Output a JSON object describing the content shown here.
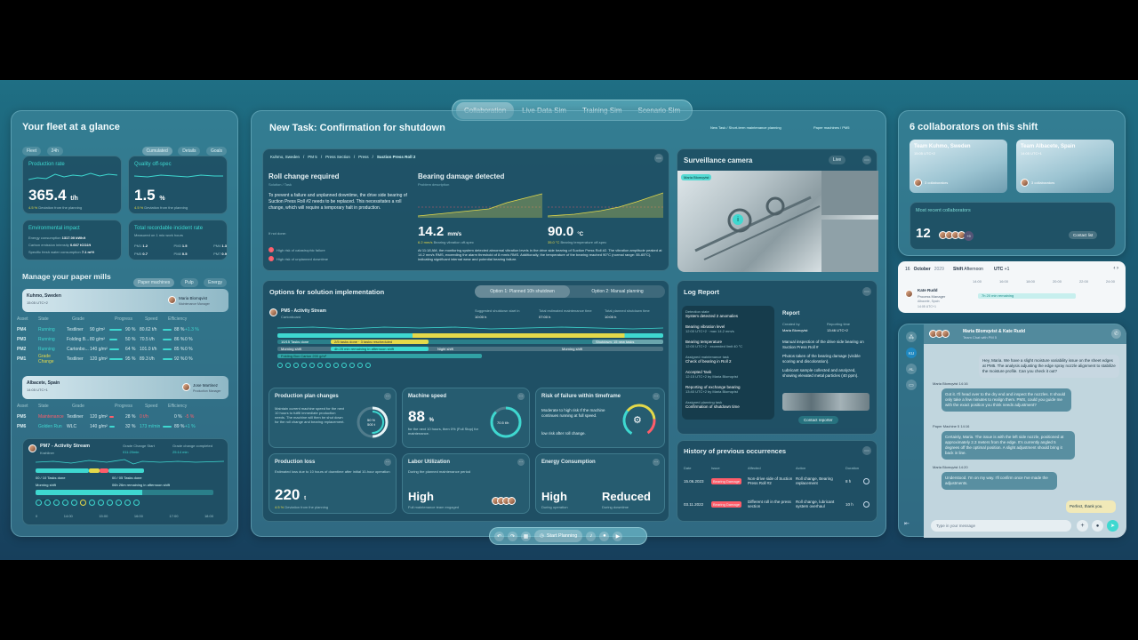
{
  "tabs": [
    "Collaboration",
    "Live Data Sim",
    "Training Sim",
    "Scenario Sim"
  ],
  "fleet": {
    "title": "Your fleet at a glance",
    "filters": [
      "Fleet",
      "24h"
    ],
    "views": [
      "Cumulated",
      "Details",
      "Goals"
    ],
    "production_rate": {
      "label": "Production rate",
      "value": "365.4",
      "unit": "t/h",
      "delta": "4.5 %",
      "note": "Deviation from the planning"
    },
    "quality": {
      "label": "Quality off-spec",
      "value": "1.5",
      "unit": "%",
      "delta": "4.5 %",
      "note": "Deviation from the planning"
    },
    "env": {
      "label": "Environmental impact",
      "lines": [
        [
          "Energy consumption",
          "1317.00 kWh/t"
        ],
        [
          "Carbon emission intensity",
          "0.667 tCO2/t"
        ],
        [
          "Specific fresh water consumption",
          "7.1 m³/t"
        ]
      ]
    },
    "trir": {
      "label": "Total recordable incident rate",
      "sub": "Measured on 1 mio work hours",
      "cells": [
        [
          "PM1",
          "1.2"
        ],
        [
          "PM3",
          "1.5"
        ],
        [
          "PM4",
          "1.3"
        ],
        [
          "PM5",
          "0.7"
        ],
        [
          "PM8",
          "0.5"
        ],
        [
          "PM7",
          "0.9"
        ]
      ]
    }
  },
  "mills": {
    "title": "Manage your paper mills",
    "chips": [
      "Paper machines",
      "Pulp",
      "Energy"
    ],
    "site1": {
      "name": "Kuhmo, Sweden",
      "time": "15:05 UTC+2",
      "person": "Maria Blomqvist",
      "role": "Maintenance Manager"
    },
    "site2": {
      "name": "Albacete, Spain",
      "time": "14:05 UTC+1",
      "person": "Jose Martinez",
      "role": "Production Manager"
    },
    "headers": [
      "Asset",
      "State",
      "Grade",
      "Progress",
      "Speed",
      "Efficiency"
    ],
    "rows1": [
      {
        "asset": "PM4",
        "state": "Running",
        "grade": "Testliner",
        "gsm": "90 g/m²",
        "prog": "90 %",
        "speed": "80.62 t/h",
        "eff": "88 %",
        "d": "+1.3 %"
      },
      {
        "asset": "PM3",
        "state": "Running",
        "grade": "Folding B...",
        "gsm": "80 g/m²",
        "prog": "50 %",
        "speed": "70.5 t/h",
        "eff": "86 %",
        "d": "0 %"
      },
      {
        "asset": "PM2",
        "state": "Running",
        "grade": "Cartonbo...",
        "gsm": "140 g/m²",
        "prog": "64 %",
        "speed": "101.0 t/h",
        "eff": "85 %",
        "d": "0 %"
      },
      {
        "asset": "PM1",
        "state": "Grade Change",
        "grade": "Testliner",
        "gsm": "120 g/m²",
        "prog": "95 %",
        "speed": "89.3 t/h",
        "eff": "92 %",
        "d": "0 %"
      }
    ],
    "rows2": [
      {
        "asset": "PM5",
        "state": "Maintenance",
        "grade": "Testliner",
        "gsm": "120 g/m²",
        "prog": "28 %",
        "speed": "0 t/h",
        "eff": "0 %",
        "d": "-5 %"
      },
      {
        "asset": "PM6",
        "state": "Golden Run",
        "grade": "WLC",
        "gsm": "140 g/m²",
        "prog": "32 %",
        "speed": "173 m/min",
        "eff": "89 %",
        "d": "+1 %"
      }
    ],
    "activity": {
      "title": "PM7 - Activity Stream",
      "sub": "Krahliner",
      "gc_start": "Grade Change Start",
      "gc_start_v": "011:20min",
      "gc_done": "Grade change completed",
      "gc_done_v": "25:14 min",
      "tasks": "00 / 10 Tasks done",
      "tasks2": "00 / 05 Tasks done",
      "shift": "Morning shift",
      "remain": "06h 26m remaining in afternoon shift",
      "paper": "Kraft paper 50 g/m²",
      "times": [
        "0",
        "14:00",
        "15:00",
        "16:00",
        "17:00",
        "18:00"
      ]
    }
  },
  "task": {
    "title": "New Task: Confirmation for shutdown",
    "crumb": "New Task / Short-term maintenance planning",
    "crumb2": "Paper machines / PM5",
    "path": [
      "Kuhmo, Sweden",
      "PM 5",
      "Press Section",
      "Press",
      "Suction Press Roll 2"
    ],
    "roll": {
      "title": "Roll change required",
      "sub": "Solution / Task",
      "body1": "To prevent a failure and unplanned downtime, the drive side bearing of Suction Press Roll #2 needs to be replaced. This necessitates a roll change, which will require a temporary halt in production.",
      "ifnot": "If not done:",
      "risk1": "High risk of catastrophic failure",
      "risk2": "High risk of unplanned downtime"
    },
    "bearing": {
      "title": "Bearing damage detected",
      "sub": "Problem description",
      "v1": "14.2",
      "u1": "mm/s",
      "d1": "6.2 mm/s",
      "n1": "Bearing vibration off-spec",
      "v2": "90.0",
      "u2": "°C",
      "d2": "35.0 °C",
      "n2": "Bearing temperature off-spec",
      "body": "At 11:18 AM, the monitoring system detected abnormal vibration levels in the drive side bearing of Suction Press Roll #2. The vibration amplitude peaked at 14.2 mm/s RMS, exceeding the alarm threshold of 8 mm/s RMS. Additionally, the temperature of the bearing reached 90°C (normal range: 55-65°C), indicating significant internal wear and potential bearing failure."
    }
  },
  "options": {
    "title": "Options for solution implementation",
    "opt1": "Option 1: Planned 10h shutdown",
    "opt2": "Option 2: Manual planning",
    "stream": "PM5 - Activity Stream",
    "stream_sub": "Cartonboard",
    "s1": "Suggested shutdown start in",
    "s1v": "10:00 h",
    "s2": "Total estimated maintenance time",
    "s2v": "07:00 h",
    "s3": "Total planned shutdown time",
    "s3v": "10:00 h",
    "g1": "10/15 Tasks done",
    "g2": "2/5 tasks done · 3 tasks rescheduled",
    "g3": "Shutdown: 15 new tasks",
    "g4": "Morning shift",
    "g5": "4h 25 min remaining in afternoon shift",
    "g6": "Night shift",
    "g7": "Morning shift",
    "g8": "Folding Box Carton 200 g/m²"
  },
  "kpis": {
    "prod": {
      "title": "Production plan changes",
      "body": "Maintain current machine speed for the next 10 hours to fulfill immediate production needs. The machine will then be shut down for the roll change and bearing replacement.",
      "ring": "50 %",
      "ring2": "500 t"
    },
    "speed": {
      "title": "Machine speed",
      "v": "88",
      "u": "%",
      "body": "for the next 10 hours, then 0% (Full Stop) for maintenance.",
      "ring": "70.5 t/h"
    },
    "risk": {
      "title": "Risk of failure within timeframe",
      "body": "Moderate to high risk If the machine continues running at full speed.",
      "body2": "low risk after roll change."
    },
    "loss": {
      "title": "Production loss",
      "body": "Estimated loss due to 10 hours of downtime after initial 10-hour operation",
      "v": "220",
      "u": "t",
      "d": "4.5 %",
      "n": "Deviation from the planning"
    },
    "labor": {
      "title": "Labor Utilization",
      "body": "During the planned maintenance period",
      "v": "High",
      "n": "Full maintenance team engaged"
    },
    "energy": {
      "title": "Energy Consumption",
      "v1": "High",
      "n1": "During operation",
      "v2": "Reduced",
      "n2": "During downtime"
    }
  },
  "camera": {
    "title": "Surveillance camera",
    "live": "Live",
    "tag": "Maria Blomqvist"
  },
  "log": {
    "title": "Log Report",
    "items": [
      [
        "Detection state",
        "System detected 2 anomalies"
      ],
      [
        "Bearing vibration level",
        "12:00 UTC+2 · max 14.2 mm/s"
      ],
      [
        "Bearing temperature",
        "12:00 UTC+2 · exceeded limit 40 °C"
      ],
      [
        "Assigned maintenance task",
        "Check of bearing in Roll 2"
      ],
      [
        "Accepted Task",
        "12:15 UTC+2 by Maria Blomqvist"
      ],
      [
        "Reporting of exchange bearing",
        "13:40 UTC+2 by Maria Blomqvist"
      ],
      [
        "Assigned planning task",
        "Confirmation of shutdown time"
      ]
    ],
    "report": "Report",
    "created": "Created by",
    "creator": "Maria Blomqvist",
    "rt": "Reporting time",
    "rtv": "13:46 UTC+2",
    "bullets": [
      "Manual inspection of the drive side bearing on Suction Press Roll #",
      "Photos taken of the bearing damage (visible scoring and discoloration).",
      "Lubricant sample collected and analyzed, showing elevated metal particles (40 ppm)."
    ],
    "contact": "Contact reporter"
  },
  "history": {
    "title": "History of previous occurrences",
    "headers": [
      "Date",
      "Issue",
      "Affected",
      "Action",
      "Duration"
    ],
    "rows": [
      [
        "15.06.2023",
        "Bearing Damage",
        "Non-drive side of Suction Press Roll #2",
        "Roll change, Bearing replacement",
        "8 h"
      ],
      [
        "03.11.2022",
        "Bearing Damage",
        "Different roll in the press section",
        "Roll change, lubricant system overhaul",
        "10 h"
      ]
    ]
  },
  "collab": {
    "title": "6 collaborators on this shift",
    "t1": "Team Kuhmo, Sweden",
    "t1s": "15:05 UTC+2",
    "t2": "Team Albacete, Spain",
    "t2s": "14:05 UTC+1",
    "c": "3 collaborators",
    "recent": "Most recent collaborators",
    "count": "12",
    "more": "+9",
    "contact": "Contact list"
  },
  "schedule": {
    "day": "16",
    "month": "October",
    "year": "2029",
    "shift": "Afternoon",
    "utc": "UTC",
    "utcv": "+1",
    "name": "Kate Rudd",
    "role": "Process Manager",
    "loc": "Albacete, Spain",
    "time": "14:05 UTC+1",
    "remaining": "7h 20 min remaining",
    "hours": [
      "14:00",
      "16:00",
      "18:00",
      "20:00",
      "22:00",
      "24:00"
    ]
  },
  "chat": {
    "title": "Maria Blomqvist & Kate Rudd",
    "sub": "Team Chat with PM 5",
    "letters": [
      "KU",
      "AL"
    ],
    "m1": "Hey, Maria. We have a slight moisture variability issue on the sheet edges at PM5. The analysis adjusting the edge spray nozzle alignment to stabilize the moisture profile. Can you check it out?",
    "m2n": "Maria Blomqvist 14:16",
    "m2": "Got it. I'll head over to the dry end and inspect the nozzles. It should only take a few minutes to realign them. PMS, could you guide me with the exact position you think needs adjustment?",
    "m3n": "Paper Machine 5 14:16",
    "m3": "Certainly, Maria. The issue is with the left side nozzle, positioned at approximately 2.3 meters from the edge. It's currently angled 5 degrees off the optimal position. A slight adjustment should bring it back in line.",
    "m4n": "Maria Blomqvist 14:20",
    "m4": "Understood. I'm on my way. I'll confirm once I've made the adjustments.",
    "m5": "Perfect, thank you.",
    "input": "Type in your message"
  },
  "toolbar": {
    "planning": "Start Planning"
  }
}
